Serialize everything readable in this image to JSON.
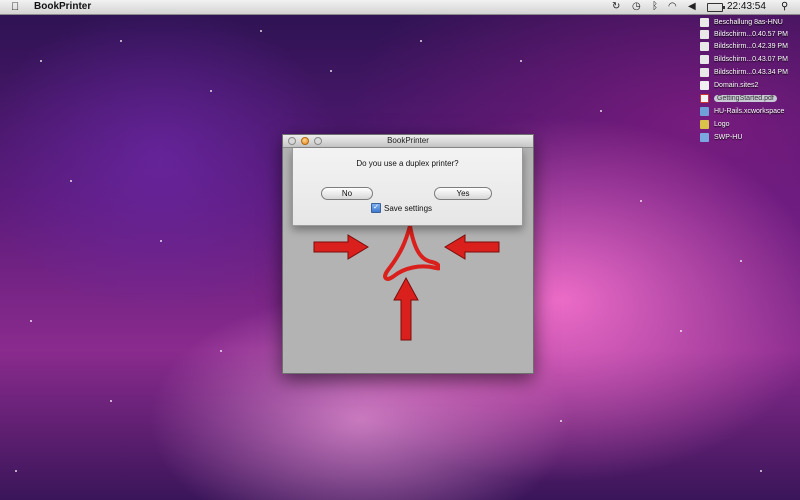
{
  "menubar": {
    "app_name": "BookPrinter",
    "clock": "22:43:54",
    "icons": [
      "apple-icon",
      "sync-icon",
      "time-machine-icon",
      "bluetooth-icon",
      "wifi-icon",
      "volume-icon",
      "battery-icon",
      "spotlight-icon"
    ]
  },
  "desktop": {
    "items": [
      {
        "label": "Beschallung 8as-HNU",
        "icon": "document-icon",
        "color": "#e8e8e8"
      },
      {
        "label": "Bildschirm...0.40.57 PM",
        "icon": "screenshot-icon",
        "color": "#e8e8e8"
      },
      {
        "label": "Bildschirm...0.42.39 PM",
        "icon": "screenshot-icon",
        "color": "#e8e8e8"
      },
      {
        "label": "Bildschirm...0.43.07 PM",
        "icon": "screenshot-icon",
        "color": "#e8e8e8"
      },
      {
        "label": "Bildschirm...0.43.34 PM",
        "icon": "screenshot-icon",
        "color": "#e8e8e8"
      },
      {
        "label": "Domain.sites2",
        "icon": "sites-icon",
        "color": "#f0f0f0"
      },
      {
        "label": "GettingStarted.pdf",
        "icon": "pdf-icon",
        "color": "#f4f4f4"
      },
      {
        "label": "HU-Rails.xcworkspace",
        "icon": "xcode-icon",
        "color": "#6fa0d8"
      },
      {
        "label": "Logo",
        "icon": "image-icon",
        "color": "#d8c24a"
      },
      {
        "label": "SWP-HU",
        "icon": "folder-icon",
        "color": "#7aa7e0"
      }
    ]
  },
  "window": {
    "title": "BookPrinter",
    "sheet": {
      "question": "Do you use a duplex printer?",
      "no_label": "No",
      "yes_label": "Yes",
      "save_settings_label": "Save settings",
      "save_settings_checked": true
    }
  },
  "colors": {
    "arrow": "#d9201c",
    "acrobat_red": "#d9201c"
  }
}
